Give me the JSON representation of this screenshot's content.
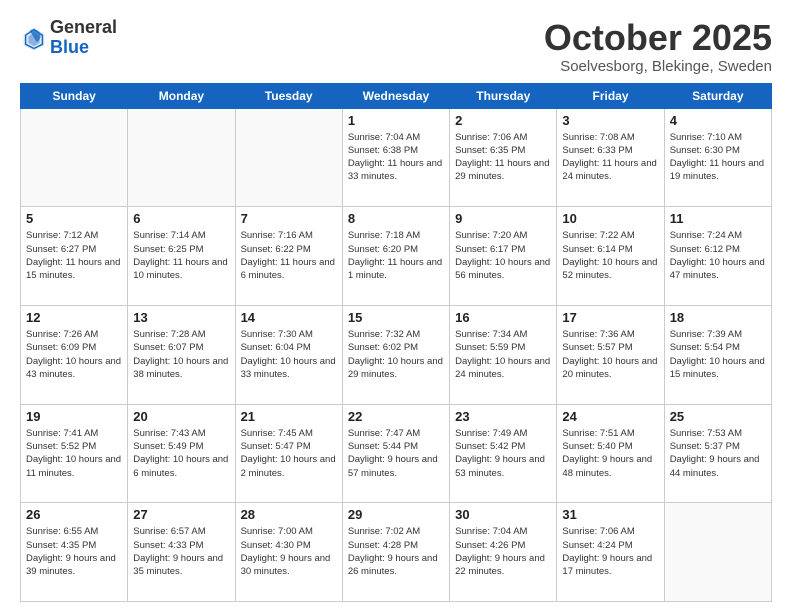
{
  "header": {
    "logo_line1": "General",
    "logo_line2": "Blue",
    "month": "October 2025",
    "location": "Soelvesborg, Blekinge, Sweden"
  },
  "days_of_week": [
    "Sunday",
    "Monday",
    "Tuesday",
    "Wednesday",
    "Thursday",
    "Friday",
    "Saturday"
  ],
  "weeks": [
    [
      {
        "day": "",
        "sunrise": "",
        "sunset": "",
        "daylight": ""
      },
      {
        "day": "",
        "sunrise": "",
        "sunset": "",
        "daylight": ""
      },
      {
        "day": "",
        "sunrise": "",
        "sunset": "",
        "daylight": ""
      },
      {
        "day": "1",
        "sunrise": "Sunrise: 7:04 AM",
        "sunset": "Sunset: 6:38 PM",
        "daylight": "Daylight: 11 hours and 33 minutes."
      },
      {
        "day": "2",
        "sunrise": "Sunrise: 7:06 AM",
        "sunset": "Sunset: 6:35 PM",
        "daylight": "Daylight: 11 hours and 29 minutes."
      },
      {
        "day": "3",
        "sunrise": "Sunrise: 7:08 AM",
        "sunset": "Sunset: 6:33 PM",
        "daylight": "Daylight: 11 hours and 24 minutes."
      },
      {
        "day": "4",
        "sunrise": "Sunrise: 7:10 AM",
        "sunset": "Sunset: 6:30 PM",
        "daylight": "Daylight: 11 hours and 19 minutes."
      }
    ],
    [
      {
        "day": "5",
        "sunrise": "Sunrise: 7:12 AM",
        "sunset": "Sunset: 6:27 PM",
        "daylight": "Daylight: 11 hours and 15 minutes."
      },
      {
        "day": "6",
        "sunrise": "Sunrise: 7:14 AM",
        "sunset": "Sunset: 6:25 PM",
        "daylight": "Daylight: 11 hours and 10 minutes."
      },
      {
        "day": "7",
        "sunrise": "Sunrise: 7:16 AM",
        "sunset": "Sunset: 6:22 PM",
        "daylight": "Daylight: 11 hours and 6 minutes."
      },
      {
        "day": "8",
        "sunrise": "Sunrise: 7:18 AM",
        "sunset": "Sunset: 6:20 PM",
        "daylight": "Daylight: 11 hours and 1 minute."
      },
      {
        "day": "9",
        "sunrise": "Sunrise: 7:20 AM",
        "sunset": "Sunset: 6:17 PM",
        "daylight": "Daylight: 10 hours and 56 minutes."
      },
      {
        "day": "10",
        "sunrise": "Sunrise: 7:22 AM",
        "sunset": "Sunset: 6:14 PM",
        "daylight": "Daylight: 10 hours and 52 minutes."
      },
      {
        "day": "11",
        "sunrise": "Sunrise: 7:24 AM",
        "sunset": "Sunset: 6:12 PM",
        "daylight": "Daylight: 10 hours and 47 minutes."
      }
    ],
    [
      {
        "day": "12",
        "sunrise": "Sunrise: 7:26 AM",
        "sunset": "Sunset: 6:09 PM",
        "daylight": "Daylight: 10 hours and 43 minutes."
      },
      {
        "day": "13",
        "sunrise": "Sunrise: 7:28 AM",
        "sunset": "Sunset: 6:07 PM",
        "daylight": "Daylight: 10 hours and 38 minutes."
      },
      {
        "day": "14",
        "sunrise": "Sunrise: 7:30 AM",
        "sunset": "Sunset: 6:04 PM",
        "daylight": "Daylight: 10 hours and 33 minutes."
      },
      {
        "day": "15",
        "sunrise": "Sunrise: 7:32 AM",
        "sunset": "Sunset: 6:02 PM",
        "daylight": "Daylight: 10 hours and 29 minutes."
      },
      {
        "day": "16",
        "sunrise": "Sunrise: 7:34 AM",
        "sunset": "Sunset: 5:59 PM",
        "daylight": "Daylight: 10 hours and 24 minutes."
      },
      {
        "day": "17",
        "sunrise": "Sunrise: 7:36 AM",
        "sunset": "Sunset: 5:57 PM",
        "daylight": "Daylight: 10 hours and 20 minutes."
      },
      {
        "day": "18",
        "sunrise": "Sunrise: 7:39 AM",
        "sunset": "Sunset: 5:54 PM",
        "daylight": "Daylight: 10 hours and 15 minutes."
      }
    ],
    [
      {
        "day": "19",
        "sunrise": "Sunrise: 7:41 AM",
        "sunset": "Sunset: 5:52 PM",
        "daylight": "Daylight: 10 hours and 11 minutes."
      },
      {
        "day": "20",
        "sunrise": "Sunrise: 7:43 AM",
        "sunset": "Sunset: 5:49 PM",
        "daylight": "Daylight: 10 hours and 6 minutes."
      },
      {
        "day": "21",
        "sunrise": "Sunrise: 7:45 AM",
        "sunset": "Sunset: 5:47 PM",
        "daylight": "Daylight: 10 hours and 2 minutes."
      },
      {
        "day": "22",
        "sunrise": "Sunrise: 7:47 AM",
        "sunset": "Sunset: 5:44 PM",
        "daylight": "Daylight: 9 hours and 57 minutes."
      },
      {
        "day": "23",
        "sunrise": "Sunrise: 7:49 AM",
        "sunset": "Sunset: 5:42 PM",
        "daylight": "Daylight: 9 hours and 53 minutes."
      },
      {
        "day": "24",
        "sunrise": "Sunrise: 7:51 AM",
        "sunset": "Sunset: 5:40 PM",
        "daylight": "Daylight: 9 hours and 48 minutes."
      },
      {
        "day": "25",
        "sunrise": "Sunrise: 7:53 AM",
        "sunset": "Sunset: 5:37 PM",
        "daylight": "Daylight: 9 hours and 44 minutes."
      }
    ],
    [
      {
        "day": "26",
        "sunrise": "Sunrise: 6:55 AM",
        "sunset": "Sunset: 4:35 PM",
        "daylight": "Daylight: 9 hours and 39 minutes."
      },
      {
        "day": "27",
        "sunrise": "Sunrise: 6:57 AM",
        "sunset": "Sunset: 4:33 PM",
        "daylight": "Daylight: 9 hours and 35 minutes."
      },
      {
        "day": "28",
        "sunrise": "Sunrise: 7:00 AM",
        "sunset": "Sunset: 4:30 PM",
        "daylight": "Daylight: 9 hours and 30 minutes."
      },
      {
        "day": "29",
        "sunrise": "Sunrise: 7:02 AM",
        "sunset": "Sunset: 4:28 PM",
        "daylight": "Daylight: 9 hours and 26 minutes."
      },
      {
        "day": "30",
        "sunrise": "Sunrise: 7:04 AM",
        "sunset": "Sunset: 4:26 PM",
        "daylight": "Daylight: 9 hours and 22 minutes."
      },
      {
        "day": "31",
        "sunrise": "Sunrise: 7:06 AM",
        "sunset": "Sunset: 4:24 PM",
        "daylight": "Daylight: 9 hours and 17 minutes."
      },
      {
        "day": "",
        "sunrise": "",
        "sunset": "",
        "daylight": ""
      }
    ]
  ]
}
